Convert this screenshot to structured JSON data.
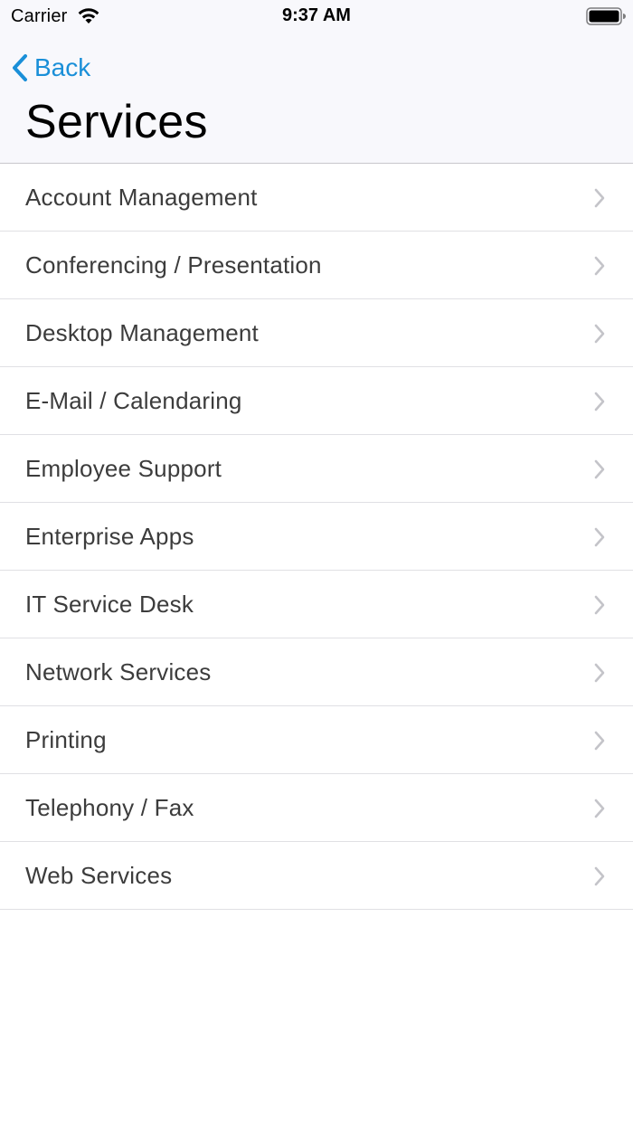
{
  "status_bar": {
    "carrier": "Carrier",
    "time": "9:37 AM",
    "wifi_icon": "wifi-icon",
    "battery_icon": "battery-icon"
  },
  "nav": {
    "back_label": "Back",
    "back_icon": "chevron-left-icon",
    "title": "Services"
  },
  "colors": {
    "accent": "#1a8fd8",
    "header_bg": "#f8f8fc",
    "separator": "#e0e0e4",
    "chevron": "#c4c4c9",
    "row_text": "#3c3c3c"
  },
  "services": [
    {
      "label": "Account Management"
    },
    {
      "label": "Conferencing / Presentation"
    },
    {
      "label": "Desktop Management"
    },
    {
      "label": "E-Mail / Calendaring"
    },
    {
      "label": "Employee Support"
    },
    {
      "label": "Enterprise Apps"
    },
    {
      "label": "IT Service Desk"
    },
    {
      "label": "Network Services"
    },
    {
      "label": "Printing"
    },
    {
      "label": "Telephony / Fax"
    },
    {
      "label": "Web Services"
    }
  ]
}
